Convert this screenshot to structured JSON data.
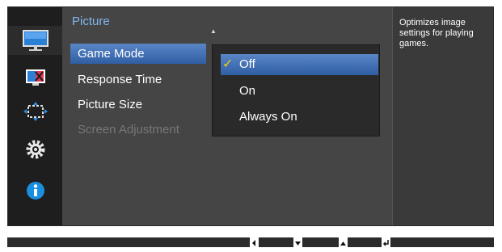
{
  "menu": {
    "title": "Picture",
    "items": [
      {
        "label": "Game Mode",
        "state": "selected"
      },
      {
        "label": "Response Time",
        "state": "normal"
      },
      {
        "label": "Picture Size",
        "state": "normal"
      },
      {
        "label": "Screen Adjustment",
        "state": "disabled"
      }
    ]
  },
  "dropdown": {
    "options": [
      "Off",
      "On",
      "Always On"
    ],
    "selected": "Off"
  },
  "help": {
    "text": "Optimizes image settings for playing games."
  },
  "categories": [
    {
      "icon": "picture-monitor-icon",
      "active": true
    },
    {
      "icon": "color-icon",
      "active": false
    },
    {
      "icon": "onscreen-display-icon",
      "active": false
    },
    {
      "icon": "system-gear-icon",
      "active": false
    },
    {
      "icon": "information-icon",
      "active": false
    }
  ],
  "bottom_buttons": [
    {
      "icon": "left-arrow-button-icon"
    },
    {
      "icon": "down-arrow-button-icon"
    },
    {
      "icon": "up-arrow-button-icon"
    },
    {
      "icon": "enter-button-icon"
    }
  ],
  "colors": {
    "accent_title": "#7fb6f0",
    "selection": "#3f6fb5",
    "check": "#f0d000",
    "info_icon": "#1a8fe0"
  }
}
